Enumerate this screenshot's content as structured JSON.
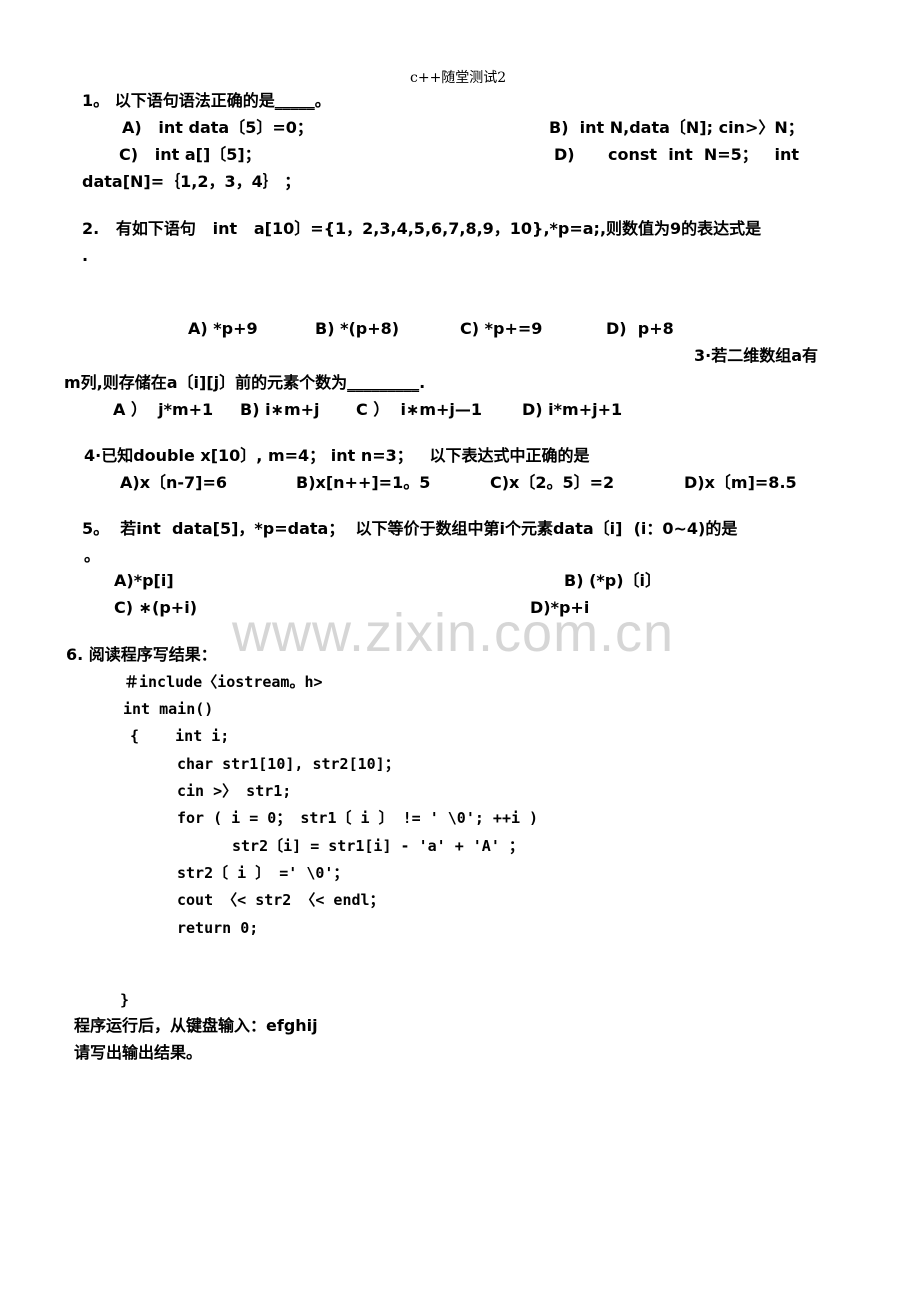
{
  "header": {
    "title": "c++随堂测试2"
  },
  "questions": {
    "q1": {
      "stem_prefix": "1。 以下语句语法正确的是",
      "blank": "_____",
      "stem_suffix": "。",
      "options": {
        "A": "A)   int data〔5〕=0；",
        "B": "B)  int N,data〔N]; cin>〉N；",
        "C": "C)   int a[]〔5]；",
        "D": "D)      const  int  N=5；   int",
        "D_cont": "data[N]=｛1,2，3，4｝ ；"
      }
    },
    "q2": {
      "stem": "2.   有如下语句   int   a[10〕={1，2,3,4,5,6,7,8,9，10},*p=a;,则数值为9的表达式是",
      "stem_cont": ".",
      "options": {
        "A": "A) *p+9",
        "B": "B) *(p+8)",
        "C": "C) *p+=9",
        "D": "D)  p+8"
      }
    },
    "q3": {
      "stem": "3·若二维数组a有",
      "stem_cont": "m列,则存储在a〔i][j〕前的元素个数为",
      "blank": "_________",
      "stem_end": ".",
      "options": {
        "A": "A ）  j*m+1",
        "B": "B) i∗m+j",
        "C": "C ）  i∗m+j—1",
        "D": "D) i*m+j+1"
      }
    },
    "q4": {
      "stem": "4·已知double x[10〕, m=4； int n=3；   以下表达式中正确的是",
      "options": {
        "A": "A)x〔n-7]=6",
        "B": "B)x[n++]=1。5",
        "C": "C)x〔2。5〕=2",
        "D": "D)x〔m]=8.5"
      }
    },
    "q5": {
      "stem": "5。  若int  data[5]，*p=data；  以下等价于数组中第i个元素data〔i]  (i：0~4)的是",
      "stem_cont": "。",
      "options": {
        "A": "A)*p[i]",
        "B": "B) (*p)〔i〕",
        "C": "C) ∗(p+i)",
        "D": "D)*p+i"
      }
    },
    "q6": {
      "stem": "6. 阅读程序写结果：",
      "code": [
        "＃include〈iostream。h>",
        "int main()",
        "{    int i;",
        "char str1[10], str2[10]；",
        "cin >〉 str1;",
        "for ( i = 0； str1〔 i 〕 != ' \\0'; ++i )",
        "str2〔i] = str1[i] - 'a' + 'A' ；",
        "str2〔 i 〕 =' \\0'；",
        "cout 〈< str2 〈< endl；",
        "return 0;",
        "}"
      ],
      "input_line": "程序运行后，从键盘输入：efghij",
      "ask_line": "请写出输出结果。"
    }
  },
  "watermark": "www.zixin.com.cn"
}
